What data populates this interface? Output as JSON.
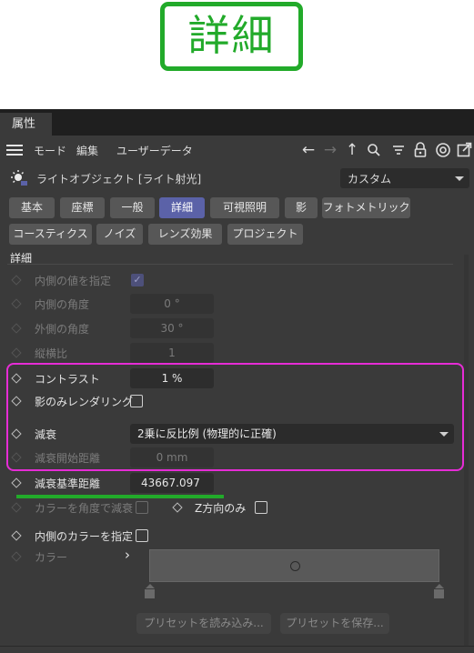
{
  "banner": {
    "label": "詳細"
  },
  "window": {
    "tab_label": "属性"
  },
  "menubar": {
    "items": [
      "モード",
      "編集",
      "ユーザーデータ"
    ]
  },
  "toolbar_icons": [
    "arrow-left-icon",
    "arrow-right-icon",
    "arrow-up-icon",
    "search-icon",
    "filter-icon",
    "lock-icon",
    "target-icon",
    "new-window-icon"
  ],
  "object": {
    "title": "ライトオブジェクト [ライト射光]",
    "preset": "カスタム"
  },
  "tabs_row1": [
    "基本",
    "座標",
    "一般",
    "詳細",
    "可視照明",
    "影",
    "フォトメトリック"
  ],
  "tabs_row2": [
    "コースティクス",
    "ノイズ",
    "レンズ効果",
    "プロジェクト"
  ],
  "active_tab": "詳細",
  "section": {
    "title": "詳細"
  },
  "params": {
    "inner_value": {
      "label": "内側の値を指定",
      "checked": true
    },
    "inner_angle": {
      "label": "内側の角度",
      "value": "0 °"
    },
    "outer_angle": {
      "label": "外側の角度",
      "value": "30 °"
    },
    "aspect": {
      "label": "縦横比",
      "value": "1"
    },
    "contrast": {
      "label": "コントラスト",
      "value": "1 %"
    },
    "shadow_only": {
      "label": "影のみレンダリング",
      "checked": false
    },
    "falloff": {
      "label": "減衰",
      "value": "2乗に反比例 (物理的に正確)"
    },
    "falloff_start": {
      "label": "減衰開始距離",
      "value": "0 mm"
    },
    "falloff_radius": {
      "label": "減衰基準距離",
      "value": "43667.097"
    },
    "color_angle": {
      "label": "カラーを角度で減衰",
      "checked": false
    },
    "z_only": {
      "label": "Z方向のみ",
      "checked": false
    },
    "inner_color": {
      "label": "内側のカラーを指定",
      "checked": false
    },
    "color": {
      "label": "カラー",
      "expand": "›"
    }
  },
  "buttons": {
    "load_preset": "プリセットを読み込み...",
    "save_preset": "プリセットを保存..."
  },
  "colors": {
    "accent": "#5b62a8",
    "highlight_box": "#e62cd6",
    "underline": "#22aa2a"
  }
}
